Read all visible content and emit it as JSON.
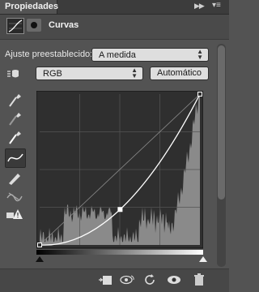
{
  "panel": {
    "tab_label": "Propiedades",
    "title": "Curvas",
    "icons": [
      "curves-adjustment-icon",
      "layer-mask-icon"
    ]
  },
  "preset": {
    "label": "Ajuste preestablecido:",
    "value": "A medida"
  },
  "channel": {
    "value": "RGB",
    "auto_label": "Automático"
  },
  "tools": [
    "on-image-adjust-icon",
    "black-point-eyedropper-icon",
    "gray-point-eyedropper-icon",
    "white-point-eyedropper-icon",
    "curve-edit-icon",
    "pencil-draw-icon",
    "smooth-curve-icon",
    "clipping-warning-icon"
  ],
  "curve": {
    "points": [
      [
        0,
        0
      ],
      [
        128,
        60
      ],
      [
        255,
        255
      ]
    ]
  },
  "footer": {
    "icons": [
      "clip-to-layer-icon",
      "view-previous-state-icon",
      "reset-icon",
      "visibility-eye-icon",
      "trash-icon"
    ]
  },
  "colors": {
    "panel_bg": "#535353",
    "graph_bg": "#2f2f2f",
    "histogram": "#8a8a8a",
    "curve": "#ffffff"
  }
}
